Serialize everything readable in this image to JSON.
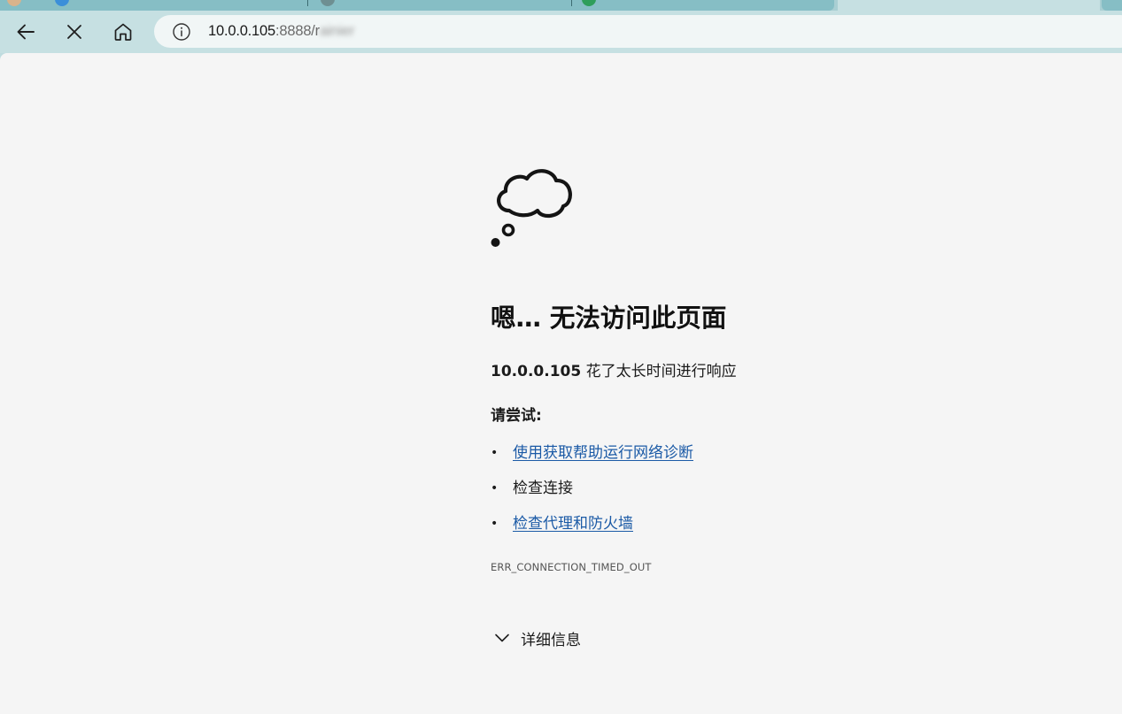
{
  "browser": {
    "address": {
      "host": "10.0.0.105",
      "rest": ":8888/r",
      "obscured": "ainier"
    },
    "icons": {
      "back": "back-arrow-icon",
      "stop": "close-icon",
      "home": "home-icon",
      "site_info": "info-icon"
    }
  },
  "error_page": {
    "title": "嗯… 无法访问此页面",
    "description_host": "10.0.0.105",
    "description_rest": " 花了太长时间进行响应",
    "try_label": "请尝试:",
    "suggestions": [
      {
        "label": "使用获取帮助运行网络诊断",
        "link": true
      },
      {
        "label": "检查连接",
        "link": false
      },
      {
        "label": "检查代理和防火墙",
        "link": true
      }
    ],
    "bullet": "•",
    "error_code": "ERR_CONNECTION_TIMED_OUT",
    "details_label": "详细信息",
    "illustration": "thought-cloud-icon"
  },
  "colors": {
    "chrome": "#c6e0e2",
    "page_background": "#f5f5f5",
    "link": "#1b5aa6"
  }
}
